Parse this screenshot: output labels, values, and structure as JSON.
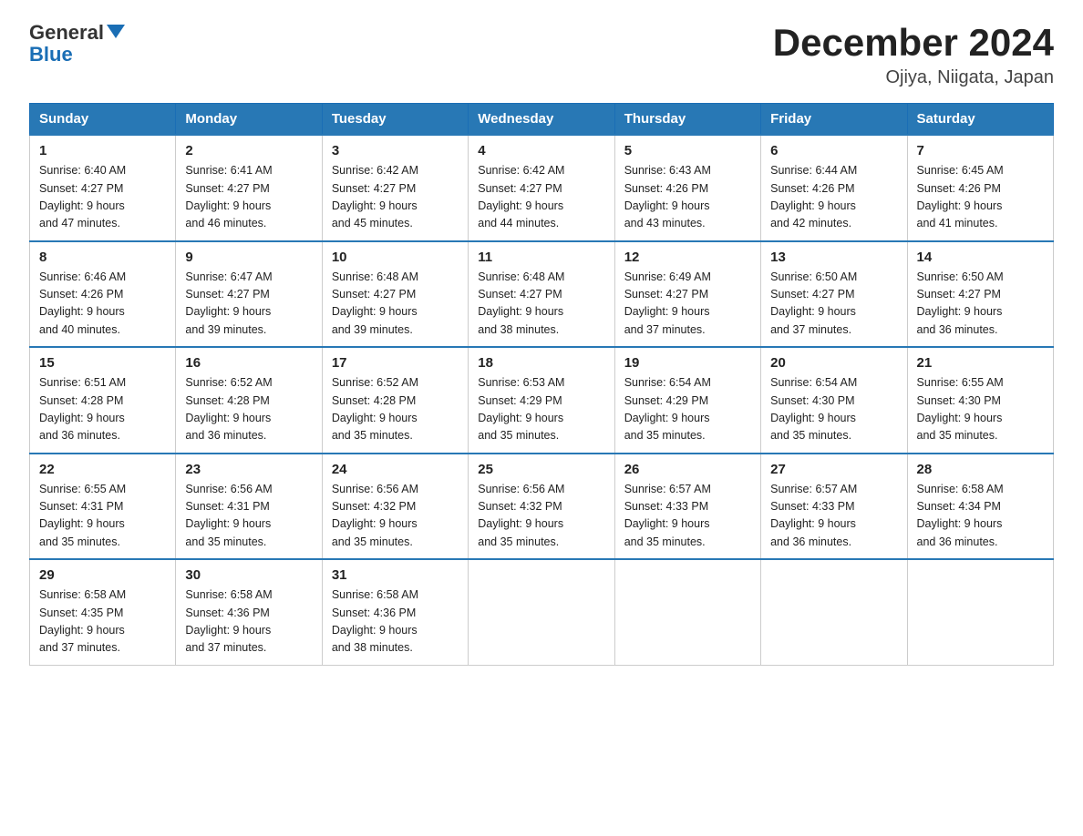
{
  "header": {
    "logo_general": "General",
    "logo_blue": "Blue",
    "month_year": "December 2024",
    "location": "Ojiya, Niigata, Japan"
  },
  "days_of_week": [
    "Sunday",
    "Monday",
    "Tuesday",
    "Wednesday",
    "Thursday",
    "Friday",
    "Saturday"
  ],
  "weeks": [
    [
      {
        "day": "1",
        "sunrise": "6:40 AM",
        "sunset": "4:27 PM",
        "daylight": "9 hours and 47 minutes."
      },
      {
        "day": "2",
        "sunrise": "6:41 AM",
        "sunset": "4:27 PM",
        "daylight": "9 hours and 46 minutes."
      },
      {
        "day": "3",
        "sunrise": "6:42 AM",
        "sunset": "4:27 PM",
        "daylight": "9 hours and 45 minutes."
      },
      {
        "day": "4",
        "sunrise": "6:42 AM",
        "sunset": "4:27 PM",
        "daylight": "9 hours and 44 minutes."
      },
      {
        "day": "5",
        "sunrise": "6:43 AM",
        "sunset": "4:26 PM",
        "daylight": "9 hours and 43 minutes."
      },
      {
        "day": "6",
        "sunrise": "6:44 AM",
        "sunset": "4:26 PM",
        "daylight": "9 hours and 42 minutes."
      },
      {
        "day": "7",
        "sunrise": "6:45 AM",
        "sunset": "4:26 PM",
        "daylight": "9 hours and 41 minutes."
      }
    ],
    [
      {
        "day": "8",
        "sunrise": "6:46 AM",
        "sunset": "4:26 PM",
        "daylight": "9 hours and 40 minutes."
      },
      {
        "day": "9",
        "sunrise": "6:47 AM",
        "sunset": "4:27 PM",
        "daylight": "9 hours and 39 minutes."
      },
      {
        "day": "10",
        "sunrise": "6:48 AM",
        "sunset": "4:27 PM",
        "daylight": "9 hours and 39 minutes."
      },
      {
        "day": "11",
        "sunrise": "6:48 AM",
        "sunset": "4:27 PM",
        "daylight": "9 hours and 38 minutes."
      },
      {
        "day": "12",
        "sunrise": "6:49 AM",
        "sunset": "4:27 PM",
        "daylight": "9 hours and 37 minutes."
      },
      {
        "day": "13",
        "sunrise": "6:50 AM",
        "sunset": "4:27 PM",
        "daylight": "9 hours and 37 minutes."
      },
      {
        "day": "14",
        "sunrise": "6:50 AM",
        "sunset": "4:27 PM",
        "daylight": "9 hours and 36 minutes."
      }
    ],
    [
      {
        "day": "15",
        "sunrise": "6:51 AM",
        "sunset": "4:28 PM",
        "daylight": "9 hours and 36 minutes."
      },
      {
        "day": "16",
        "sunrise": "6:52 AM",
        "sunset": "4:28 PM",
        "daylight": "9 hours and 36 minutes."
      },
      {
        "day": "17",
        "sunrise": "6:52 AM",
        "sunset": "4:28 PM",
        "daylight": "9 hours and 35 minutes."
      },
      {
        "day": "18",
        "sunrise": "6:53 AM",
        "sunset": "4:29 PM",
        "daylight": "9 hours and 35 minutes."
      },
      {
        "day": "19",
        "sunrise": "6:54 AM",
        "sunset": "4:29 PM",
        "daylight": "9 hours and 35 minutes."
      },
      {
        "day": "20",
        "sunrise": "6:54 AM",
        "sunset": "4:30 PM",
        "daylight": "9 hours and 35 minutes."
      },
      {
        "day": "21",
        "sunrise": "6:55 AM",
        "sunset": "4:30 PM",
        "daylight": "9 hours and 35 minutes."
      }
    ],
    [
      {
        "day": "22",
        "sunrise": "6:55 AM",
        "sunset": "4:31 PM",
        "daylight": "9 hours and 35 minutes."
      },
      {
        "day": "23",
        "sunrise": "6:56 AM",
        "sunset": "4:31 PM",
        "daylight": "9 hours and 35 minutes."
      },
      {
        "day": "24",
        "sunrise": "6:56 AM",
        "sunset": "4:32 PM",
        "daylight": "9 hours and 35 minutes."
      },
      {
        "day": "25",
        "sunrise": "6:56 AM",
        "sunset": "4:32 PM",
        "daylight": "9 hours and 35 minutes."
      },
      {
        "day": "26",
        "sunrise": "6:57 AM",
        "sunset": "4:33 PM",
        "daylight": "9 hours and 35 minutes."
      },
      {
        "day": "27",
        "sunrise": "6:57 AM",
        "sunset": "4:33 PM",
        "daylight": "9 hours and 36 minutes."
      },
      {
        "day": "28",
        "sunrise": "6:58 AM",
        "sunset": "4:34 PM",
        "daylight": "9 hours and 36 minutes."
      }
    ],
    [
      {
        "day": "29",
        "sunrise": "6:58 AM",
        "sunset": "4:35 PM",
        "daylight": "9 hours and 37 minutes."
      },
      {
        "day": "30",
        "sunrise": "6:58 AM",
        "sunset": "4:36 PM",
        "daylight": "9 hours and 37 minutes."
      },
      {
        "day": "31",
        "sunrise": "6:58 AM",
        "sunset": "4:36 PM",
        "daylight": "9 hours and 38 minutes."
      },
      null,
      null,
      null,
      null
    ]
  ],
  "labels": {
    "sunrise": "Sunrise:",
    "sunset": "Sunset:",
    "daylight": "Daylight:"
  }
}
